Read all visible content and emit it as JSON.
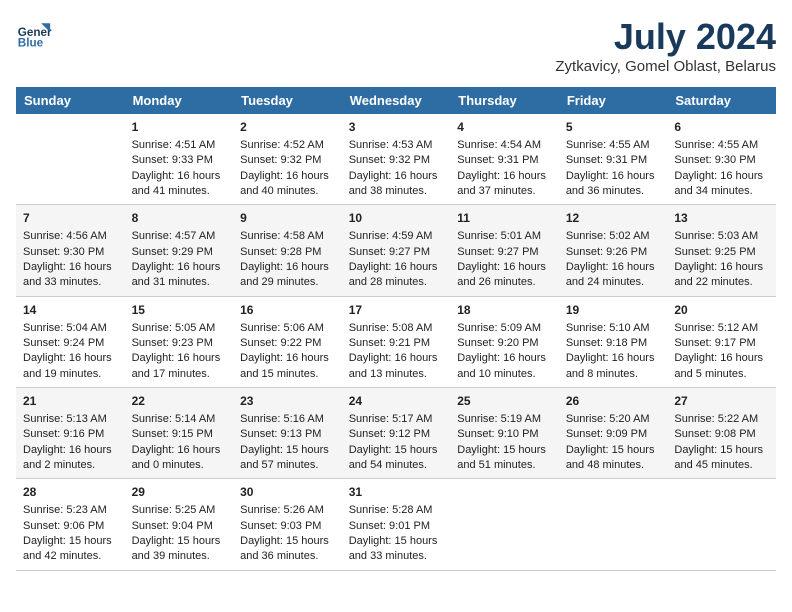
{
  "header": {
    "logo_line1": "General",
    "logo_line2": "Blue",
    "title": "July 2024",
    "subtitle": "Zytkavicy, Gomel Oblast, Belarus"
  },
  "days_of_week": [
    "Sunday",
    "Monday",
    "Tuesday",
    "Wednesday",
    "Thursday",
    "Friday",
    "Saturday"
  ],
  "weeks": [
    [
      {
        "day": "",
        "sunrise": "",
        "sunset": "",
        "daylight": ""
      },
      {
        "day": "1",
        "sunrise": "Sunrise: 4:51 AM",
        "sunset": "Sunset: 9:33 PM",
        "daylight": "Daylight: 16 hours and 41 minutes."
      },
      {
        "day": "2",
        "sunrise": "Sunrise: 4:52 AM",
        "sunset": "Sunset: 9:32 PM",
        "daylight": "Daylight: 16 hours and 40 minutes."
      },
      {
        "day": "3",
        "sunrise": "Sunrise: 4:53 AM",
        "sunset": "Sunset: 9:32 PM",
        "daylight": "Daylight: 16 hours and 38 minutes."
      },
      {
        "day": "4",
        "sunrise": "Sunrise: 4:54 AM",
        "sunset": "Sunset: 9:31 PM",
        "daylight": "Daylight: 16 hours and 37 minutes."
      },
      {
        "day": "5",
        "sunrise": "Sunrise: 4:55 AM",
        "sunset": "Sunset: 9:31 PM",
        "daylight": "Daylight: 16 hours and 36 minutes."
      },
      {
        "day": "6",
        "sunrise": "Sunrise: 4:55 AM",
        "sunset": "Sunset: 9:30 PM",
        "daylight": "Daylight: 16 hours and 34 minutes."
      }
    ],
    [
      {
        "day": "7",
        "sunrise": "Sunrise: 4:56 AM",
        "sunset": "Sunset: 9:30 PM",
        "daylight": "Daylight: 16 hours and 33 minutes."
      },
      {
        "day": "8",
        "sunrise": "Sunrise: 4:57 AM",
        "sunset": "Sunset: 9:29 PM",
        "daylight": "Daylight: 16 hours and 31 minutes."
      },
      {
        "day": "9",
        "sunrise": "Sunrise: 4:58 AM",
        "sunset": "Sunset: 9:28 PM",
        "daylight": "Daylight: 16 hours and 29 minutes."
      },
      {
        "day": "10",
        "sunrise": "Sunrise: 4:59 AM",
        "sunset": "Sunset: 9:27 PM",
        "daylight": "Daylight: 16 hours and 28 minutes."
      },
      {
        "day": "11",
        "sunrise": "Sunrise: 5:01 AM",
        "sunset": "Sunset: 9:27 PM",
        "daylight": "Daylight: 16 hours and 26 minutes."
      },
      {
        "day": "12",
        "sunrise": "Sunrise: 5:02 AM",
        "sunset": "Sunset: 9:26 PM",
        "daylight": "Daylight: 16 hours and 24 minutes."
      },
      {
        "day": "13",
        "sunrise": "Sunrise: 5:03 AM",
        "sunset": "Sunset: 9:25 PM",
        "daylight": "Daylight: 16 hours and 22 minutes."
      }
    ],
    [
      {
        "day": "14",
        "sunrise": "Sunrise: 5:04 AM",
        "sunset": "Sunset: 9:24 PM",
        "daylight": "Daylight: 16 hours and 19 minutes."
      },
      {
        "day": "15",
        "sunrise": "Sunrise: 5:05 AM",
        "sunset": "Sunset: 9:23 PM",
        "daylight": "Daylight: 16 hours and 17 minutes."
      },
      {
        "day": "16",
        "sunrise": "Sunrise: 5:06 AM",
        "sunset": "Sunset: 9:22 PM",
        "daylight": "Daylight: 16 hours and 15 minutes."
      },
      {
        "day": "17",
        "sunrise": "Sunrise: 5:08 AM",
        "sunset": "Sunset: 9:21 PM",
        "daylight": "Daylight: 16 hours and 13 minutes."
      },
      {
        "day": "18",
        "sunrise": "Sunrise: 5:09 AM",
        "sunset": "Sunset: 9:20 PM",
        "daylight": "Daylight: 16 hours and 10 minutes."
      },
      {
        "day": "19",
        "sunrise": "Sunrise: 5:10 AM",
        "sunset": "Sunset: 9:18 PM",
        "daylight": "Daylight: 16 hours and 8 minutes."
      },
      {
        "day": "20",
        "sunrise": "Sunrise: 5:12 AM",
        "sunset": "Sunset: 9:17 PM",
        "daylight": "Daylight: 16 hours and 5 minutes."
      }
    ],
    [
      {
        "day": "21",
        "sunrise": "Sunrise: 5:13 AM",
        "sunset": "Sunset: 9:16 PM",
        "daylight": "Daylight: 16 hours and 2 minutes."
      },
      {
        "day": "22",
        "sunrise": "Sunrise: 5:14 AM",
        "sunset": "Sunset: 9:15 PM",
        "daylight": "Daylight: 16 hours and 0 minutes."
      },
      {
        "day": "23",
        "sunrise": "Sunrise: 5:16 AM",
        "sunset": "Sunset: 9:13 PM",
        "daylight": "Daylight: 15 hours and 57 minutes."
      },
      {
        "day": "24",
        "sunrise": "Sunrise: 5:17 AM",
        "sunset": "Sunset: 9:12 PM",
        "daylight": "Daylight: 15 hours and 54 minutes."
      },
      {
        "day": "25",
        "sunrise": "Sunrise: 5:19 AM",
        "sunset": "Sunset: 9:10 PM",
        "daylight": "Daylight: 15 hours and 51 minutes."
      },
      {
        "day": "26",
        "sunrise": "Sunrise: 5:20 AM",
        "sunset": "Sunset: 9:09 PM",
        "daylight": "Daylight: 15 hours and 48 minutes."
      },
      {
        "day": "27",
        "sunrise": "Sunrise: 5:22 AM",
        "sunset": "Sunset: 9:08 PM",
        "daylight": "Daylight: 15 hours and 45 minutes."
      }
    ],
    [
      {
        "day": "28",
        "sunrise": "Sunrise: 5:23 AM",
        "sunset": "Sunset: 9:06 PM",
        "daylight": "Daylight: 15 hours and 42 minutes."
      },
      {
        "day": "29",
        "sunrise": "Sunrise: 5:25 AM",
        "sunset": "Sunset: 9:04 PM",
        "daylight": "Daylight: 15 hours and 39 minutes."
      },
      {
        "day": "30",
        "sunrise": "Sunrise: 5:26 AM",
        "sunset": "Sunset: 9:03 PM",
        "daylight": "Daylight: 15 hours and 36 minutes."
      },
      {
        "day": "31",
        "sunrise": "Sunrise: 5:28 AM",
        "sunset": "Sunset: 9:01 PM",
        "daylight": "Daylight: 15 hours and 33 minutes."
      },
      {
        "day": "",
        "sunrise": "",
        "sunset": "",
        "daylight": ""
      },
      {
        "day": "",
        "sunrise": "",
        "sunset": "",
        "daylight": ""
      },
      {
        "day": "",
        "sunrise": "",
        "sunset": "",
        "daylight": ""
      }
    ]
  ]
}
